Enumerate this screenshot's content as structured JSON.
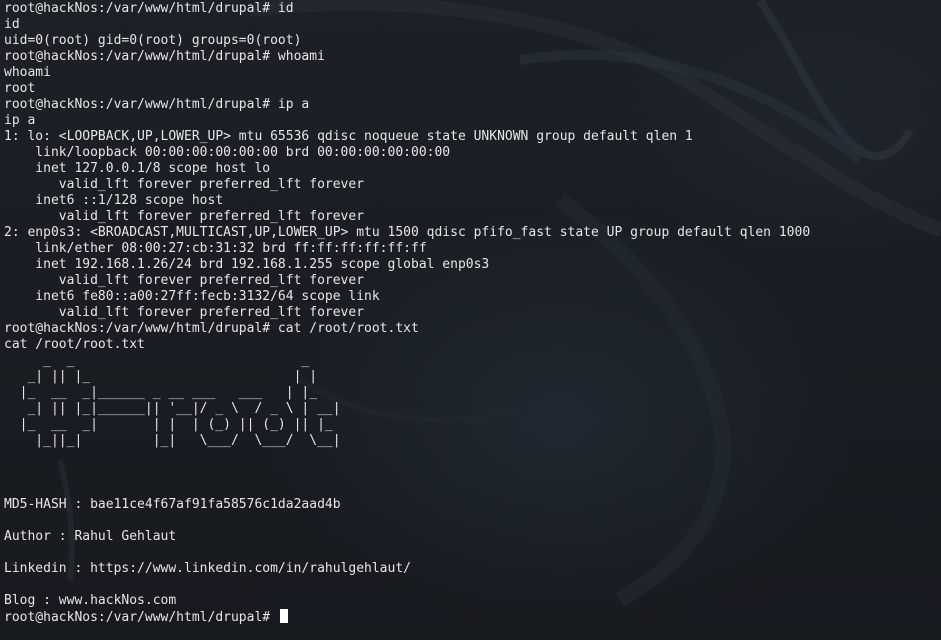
{
  "terminal": {
    "lines": [
      "root@hackNos:/var/www/html/drupal# id",
      "id",
      "uid=0(root) gid=0(root) groups=0(root)",
      "root@hackNos:/var/www/html/drupal# whoami",
      "whoami",
      "root",
      "root@hackNos:/var/www/html/drupal# ip a",
      "ip a",
      "1: lo: <LOOPBACK,UP,LOWER_UP> mtu 65536 qdisc noqueue state UNKNOWN group default qlen 1",
      "    link/loopback 00:00:00:00:00:00 brd 00:00:00:00:00:00",
      "    inet 127.0.0.1/8 scope host lo",
      "       valid_lft forever preferred_lft forever",
      "    inet6 ::1/128 scope host",
      "       valid_lft forever preferred_lft forever",
      "2: enp0s3: <BROADCAST,MULTICAST,UP,LOWER_UP> mtu 1500 qdisc pfifo_fast state UP group default qlen 1000",
      "    link/ether 08:00:27:cb:31:32 brd ff:ff:ff:ff:ff:ff",
      "    inet 192.168.1.26/24 brd 192.168.1.255 scope global enp0s3",
      "       valid_lft forever preferred_lft forever",
      "    inet6 fe80::a00:27ff:fecb:3132/64 scope link",
      "       valid_lft forever preferred_lft forever",
      "root@hackNos:/var/www/html/drupal# cat /root/root.txt",
      "cat /root/root.txt",
      "     _  _                             _   ",
      "   _| || |_                          | |  ",
      "  |_  __  _|______ _ __ ___   ___   | |_ ",
      "   _| || |_|______|| '__|/ _ \\  / _ \\ | __|",
      "  |_  __  _|       | |  | (_) || (_) || |_ ",
      "    |_||_|         |_|   \\___/  \\___/  \\__|",
      "",
      "",
      "",
      "MD5-HASH : bae11ce4f67af91fa58576c1da2aad4b",
      "",
      "Author : Rahul Gehlaut",
      "",
      "Linkedin : https://www.linkedin.com/in/rahulgehlaut/",
      "",
      "Blog : www.hackNos.com"
    ],
    "prompt": "root@hackNos:/var/www/html/drupal# "
  }
}
